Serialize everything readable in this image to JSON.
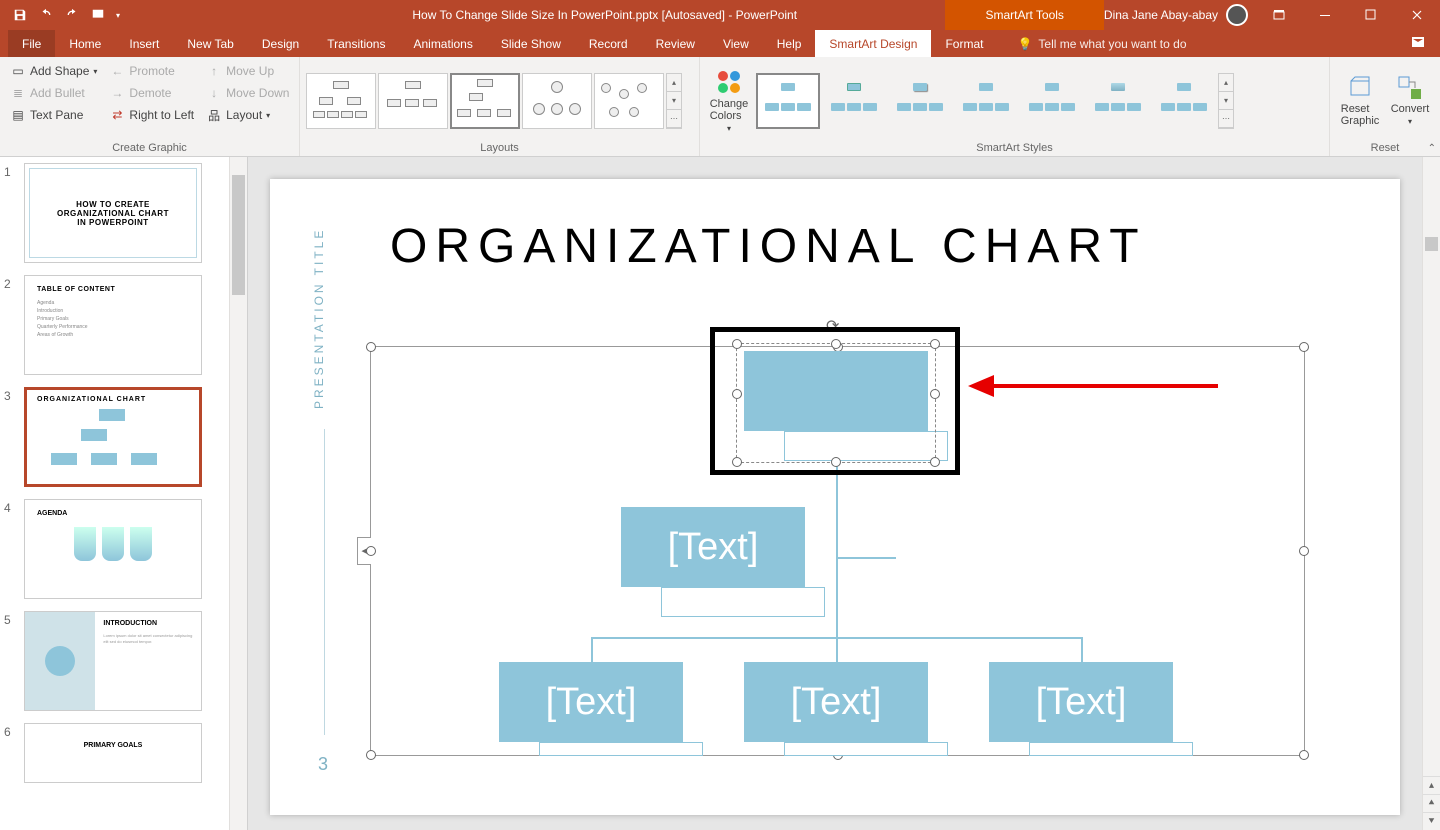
{
  "titlebar": {
    "document_title": "How To Change Slide Size In PowerPoint.pptx [Autosaved]  -  PowerPoint",
    "contextual_tools": "SmartArt Tools",
    "user_name": "Dina Jane Abay-abay"
  },
  "tabs": {
    "file": "File",
    "items": [
      "Home",
      "Insert",
      "New Tab",
      "Design",
      "Transitions",
      "Animations",
      "Slide Show",
      "Record",
      "Review",
      "View",
      "Help"
    ],
    "smartart_design": "SmartArt Design",
    "format": "Format",
    "tell_me": "Tell me what you want to do"
  },
  "ribbon": {
    "create_graphic": {
      "label": "Create Graphic",
      "add_shape": "Add Shape",
      "add_bullet": "Add Bullet",
      "text_pane": "Text Pane",
      "promote": "Promote",
      "demote": "Demote",
      "right_to_left": "Right to Left",
      "move_up": "Move Up",
      "move_down": "Move Down",
      "layout": "Layout"
    },
    "layouts": {
      "label": "Layouts"
    },
    "change_colors": "Change Colors",
    "smartart_styles": {
      "label": "SmartArt Styles"
    },
    "reset": {
      "label": "Reset",
      "reset_graphic": "Reset Graphic",
      "convert": "Convert"
    }
  },
  "thumbnails": {
    "1": {
      "title1": "HOW TO CREATE",
      "title2": "ORGANIZATIONAL CHART",
      "title3": "IN POWERPOINT"
    },
    "2": {
      "heading": "TABLE OF CONTENT",
      "items": [
        "Agenda",
        "Introduction",
        "Primary Goals",
        "Quarterly Performance",
        "Areas of Growth"
      ]
    },
    "3": {
      "heading": "ORGANIZATIONAL CHART"
    },
    "4": {
      "heading": "AGENDA"
    },
    "5": {
      "heading": "INTRODUCTION"
    },
    "6": {
      "heading": "PRIMARY GOALS"
    }
  },
  "slide": {
    "side_title": "PRESENTATION TITLE",
    "page_num": "3",
    "title": "ORGANIZATIONAL CHART",
    "box_placeholder": "[Text]"
  }
}
